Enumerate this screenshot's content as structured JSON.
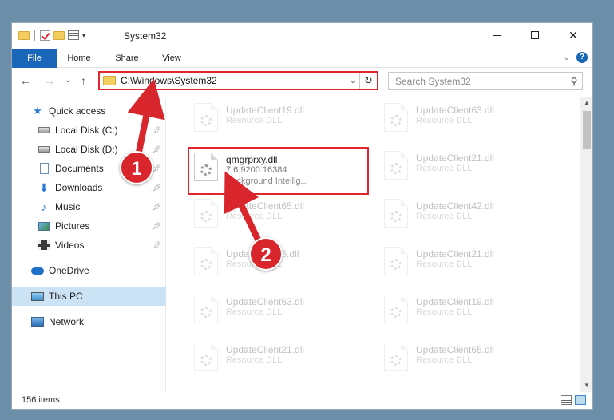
{
  "window": {
    "title": "System32",
    "controls": {
      "minimize": "minimize",
      "maximize": "maximize",
      "close": "✕"
    }
  },
  "ribbon": {
    "tabs": [
      {
        "label": "File"
      },
      {
        "label": "Home"
      },
      {
        "label": "Share"
      },
      {
        "label": "View"
      }
    ]
  },
  "nav": {
    "back": "←",
    "forward": "→",
    "recent": "⌄",
    "up": "↑",
    "address": "C:\\Windows\\System32",
    "refresh": "↻",
    "search_placeholder": "Search System32"
  },
  "sidebar": {
    "items": [
      {
        "label": "Quick access",
        "icon": "star-icon"
      },
      {
        "label": "Local Disk (C:)",
        "icon": "disk-icon",
        "pinned": true
      },
      {
        "label": "Local Disk (D:)",
        "icon": "disk-icon",
        "pinned": true
      },
      {
        "label": "Documents",
        "icon": "documents-icon",
        "pinned": true
      },
      {
        "label": "Downloads",
        "icon": "downloads-icon",
        "pinned": true
      },
      {
        "label": "Music",
        "icon": "music-icon",
        "pinned": true
      },
      {
        "label": "Pictures",
        "icon": "pictures-icon",
        "pinned": true
      },
      {
        "label": "Videos",
        "icon": "videos-icon",
        "pinned": true
      },
      {
        "label": "OneDrive",
        "icon": "onedrive-icon"
      },
      {
        "label": "This PC",
        "icon": "this-pc-icon",
        "selected": true
      },
      {
        "label": "Network",
        "icon": "network-icon"
      }
    ]
  },
  "files": {
    "left": [
      {
        "name": "UpdateClient19.dll",
        "type": "Resource DLL"
      },
      {
        "name": "qmgrprxy.dll",
        "version": "7.6.9200.16384",
        "desc": "Background Intellig..."
      },
      {
        "name": "UpdateClient65.dll",
        "type": "Resource DLL"
      },
      {
        "name": "UpdateClient5.dll",
        "type": "Resource DLL"
      },
      {
        "name": "UpdateClient63.dll",
        "type": "Resource DLL"
      },
      {
        "name": "UpdateClient21.dll",
        "type": "Resource DLL"
      }
    ],
    "right": [
      {
        "name": "UpdateClient63.dll",
        "type": "Resource DLL"
      },
      {
        "name": "UpdateClient21.dll",
        "type": "Resource DLL"
      },
      {
        "name": "UpdateClient42.dll",
        "type": "Resource DLL"
      },
      {
        "name": "UpdateClient21.dll",
        "type": "Resource DLL"
      },
      {
        "name": "UpdateClient19.dll",
        "type": "Resource DLL"
      },
      {
        "name": "UpdateClient65.dll",
        "type": "Resource DLL"
      }
    ]
  },
  "status": {
    "items": "156 items"
  },
  "annotations": {
    "step1": "1",
    "step2": "2"
  },
  "colors": {
    "accent": "#1a66b8",
    "highlight": "#e0252c",
    "selection": "#cce3f6"
  }
}
